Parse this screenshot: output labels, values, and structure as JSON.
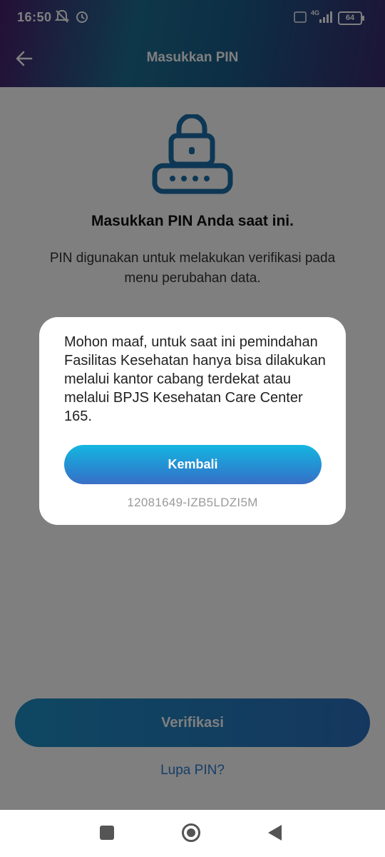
{
  "status_bar": {
    "time": "16:50",
    "network": "4G",
    "battery": "64"
  },
  "header": {
    "title": "Masukkan PIN"
  },
  "main": {
    "title": "Masukkan PIN Anda saat ini.",
    "subtitle": "PIN digunakan untuk melakukan verifikasi pada menu perubahan data.",
    "verify_label": "Verifikasi",
    "forgot_label": "Lupa PIN?"
  },
  "dialog": {
    "message": "Mohon maaf, untuk saat ini pemindahan Fasilitas Kesehatan hanya bisa dilakukan melalui kantor cabang terdekat atau melalui BPJS Kesehatan Care Center 165.",
    "button_label": "Kembali",
    "code": "12081649-IZB5LDZI5M"
  },
  "colors": {
    "accent": "#1a6fa8",
    "dialog_button": "#1f9fd9"
  },
  "icons": [
    "back-arrow-icon",
    "lock-icon",
    "notifications-off-icon",
    "alarm-icon",
    "signal-icon",
    "battery-icon"
  ]
}
